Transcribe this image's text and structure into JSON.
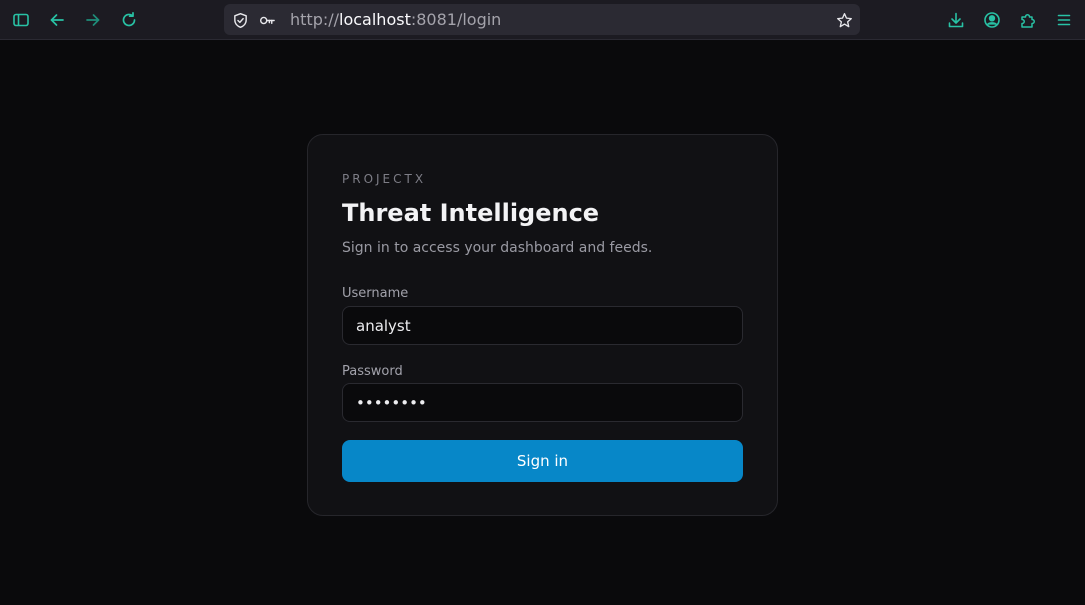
{
  "browser": {
    "url_scheme": "http://",
    "url_host": "localhost",
    "url_rest": ":8081/login",
    "accent": "#28c2a5"
  },
  "login": {
    "brand": "PROJECTX",
    "title": "Threat Intelligence",
    "subtitle": "Sign in to access your dashboard and feeds.",
    "username_label": "Username",
    "username_value": "analyst",
    "password_label": "Password",
    "password_value": "password",
    "submit_label": "Sign in",
    "button_color": "#0787c8"
  }
}
